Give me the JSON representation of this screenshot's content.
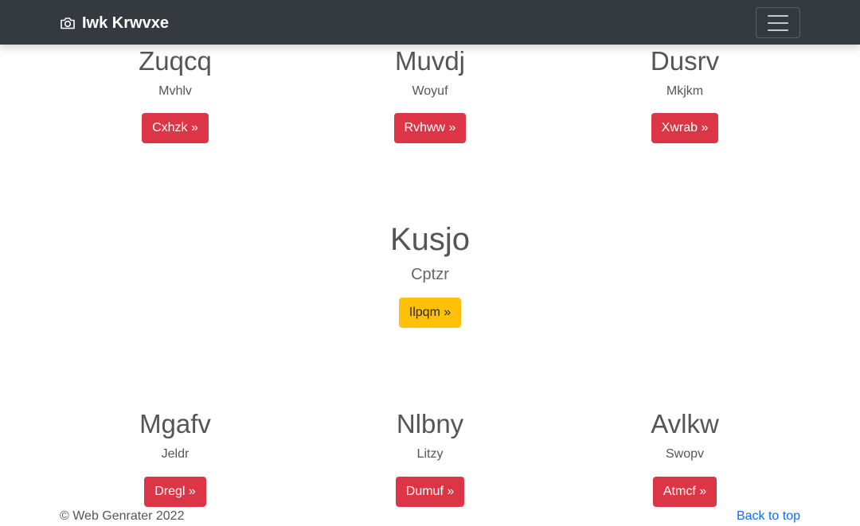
{
  "navbar": {
    "brand": "Iwk Krwvxe",
    "brand_icon": "camera-icon",
    "toggler_icon": "hamburger-menu-icon"
  },
  "row_top": [
    {
      "title": "Zuqcq",
      "text": "Mvhlv",
      "button": "Cxhzk »"
    },
    {
      "title": "Muvdj",
      "text": "Woyuf",
      "button": "Rvhww »"
    },
    {
      "title": "Dusrv",
      "text": "Mkjkm",
      "button": "Xwrab »"
    }
  ],
  "featured": {
    "title": "Kusjo",
    "text": "Cptzr",
    "button": "Ilpqm »"
  },
  "row_bottom": [
    {
      "title": "Mgafv",
      "text": "Jeldr",
      "button": "Dregl »"
    },
    {
      "title": "Nlbny",
      "text": "Litzy",
      "button": "Dumuf »"
    },
    {
      "title": "Avlkw",
      "text": "Swopv",
      "button": "Atmcf »"
    }
  ],
  "footer": {
    "copyright": "© Web Genrater 2022",
    "back_to_top": "Back to top"
  },
  "colors": {
    "navbar_bg": "#343a40",
    "danger": "#dc3545",
    "warning": "#ffc107",
    "link": "#0d6efd"
  }
}
